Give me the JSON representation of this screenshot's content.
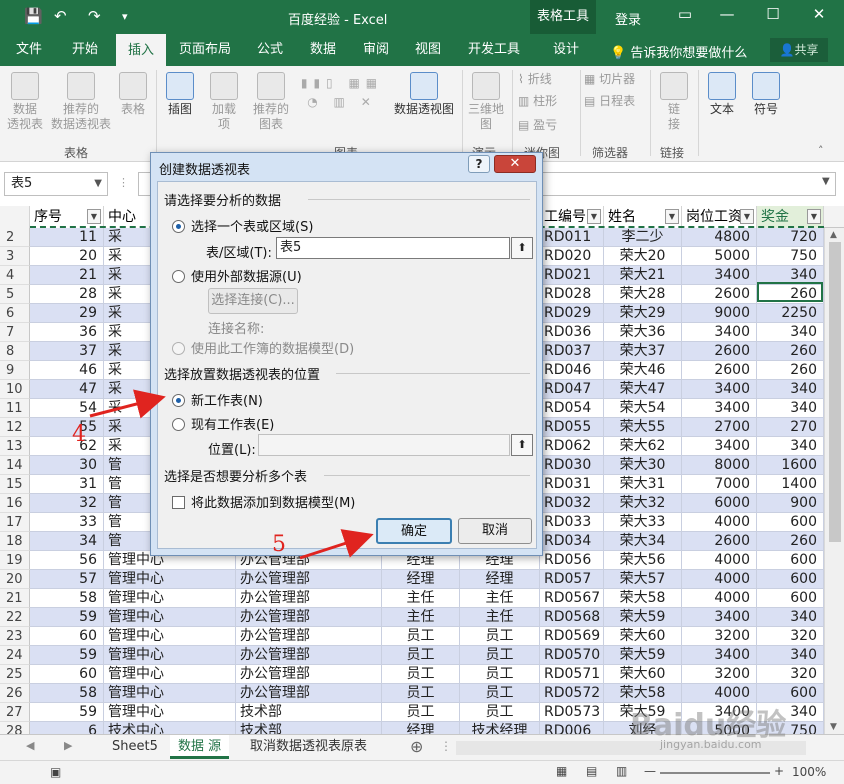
{
  "window": {
    "title": "百度经验 - Excel",
    "context_tab": "表格工具",
    "login": "登录",
    "quick_access": [
      "save-icon",
      "undo-icon",
      "redo-icon",
      "customize-icon"
    ],
    "controls": [
      "ribbon-display-icon",
      "minimize-icon",
      "maximize-icon",
      "close-icon"
    ]
  },
  "ribbon_tabs": [
    "文件",
    "开始",
    "插入",
    "页面布局",
    "公式",
    "数据",
    "审阅",
    "视图",
    "开发工具",
    "设计"
  ],
  "active_tab": "插入",
  "tell_me": "告诉我你想要做什么",
  "share": "共享",
  "ribbon": {
    "buttons": [
      "数据\n透视表",
      "推荐的\n数据透视表",
      "表格",
      "插图",
      "加载\n项",
      "推荐的\n图表",
      "数据透视图",
      "三维地\n图",
      "折线",
      "柱形",
      "盈亏",
      "切片器",
      "日程表",
      "链\n接",
      "文本",
      "符号"
    ],
    "groups": [
      "表格",
      "图表",
      "演示",
      "迷你图",
      "筛选器",
      "链接"
    ]
  },
  "name_box": "表5",
  "columns": [
    "序号",
    "中心",
    "",
    "",
    "",
    "工编号",
    "姓名",
    "岗位工资",
    "奖金"
  ],
  "rows": [
    {
      "n": "2",
      "seq": "11",
      "center": "采",
      "dept": "",
      "pos": "",
      "role": "",
      "id": "RD011",
      "name": "李二少",
      "wage": "4800",
      "bonus": "720"
    },
    {
      "n": "3",
      "seq": "20",
      "center": "采",
      "dept": "",
      "pos": "",
      "role": "",
      "id": "RD020",
      "name": "荣大20",
      "wage": "5000",
      "bonus": "750"
    },
    {
      "n": "4",
      "seq": "21",
      "center": "采",
      "dept": "",
      "pos": "",
      "role": "",
      "id": "RD021",
      "name": "荣大21",
      "wage": "3400",
      "bonus": "340"
    },
    {
      "n": "5",
      "seq": "28",
      "center": "采",
      "dept": "",
      "pos": "",
      "role": "",
      "id": "RD028",
      "name": "荣大28",
      "wage": "2600",
      "bonus": "260"
    },
    {
      "n": "6",
      "seq": "29",
      "center": "采",
      "dept": "",
      "pos": "",
      "role": "",
      "id": "RD029",
      "name": "荣大29",
      "wage": "9000",
      "bonus": "2250"
    },
    {
      "n": "7",
      "seq": "36",
      "center": "采",
      "dept": "",
      "pos": "",
      "role": "",
      "id": "RD036",
      "name": "荣大36",
      "wage": "3400",
      "bonus": "340"
    },
    {
      "n": "8",
      "seq": "37",
      "center": "采",
      "dept": "",
      "pos": "",
      "role": "",
      "id": "RD037",
      "name": "荣大37",
      "wage": "2600",
      "bonus": "260"
    },
    {
      "n": "9",
      "seq": "46",
      "center": "采",
      "dept": "",
      "pos": "",
      "role": "",
      "id": "RD046",
      "name": "荣大46",
      "wage": "2600",
      "bonus": "260"
    },
    {
      "n": "10",
      "seq": "47",
      "center": "采",
      "dept": "",
      "pos": "",
      "role": "",
      "id": "RD047",
      "name": "荣大47",
      "wage": "3400",
      "bonus": "340"
    },
    {
      "n": "11",
      "seq": "54",
      "center": "采",
      "dept": "",
      "pos": "",
      "role": "",
      "id": "RD054",
      "name": "荣大54",
      "wage": "3400",
      "bonus": "340"
    },
    {
      "n": "12",
      "seq": "55",
      "center": "采",
      "dept": "",
      "pos": "",
      "role": "",
      "id": "RD055",
      "name": "荣大55",
      "wage": "2700",
      "bonus": "270"
    },
    {
      "n": "13",
      "seq": "62",
      "center": "采",
      "dept": "",
      "pos": "",
      "role": "",
      "id": "RD062",
      "name": "荣大62",
      "wage": "3400",
      "bonus": "340"
    },
    {
      "n": "14",
      "seq": "30",
      "center": "管",
      "dept": "",
      "pos": "",
      "role": "",
      "id": "RD030",
      "name": "荣大30",
      "wage": "8000",
      "bonus": "1600"
    },
    {
      "n": "15",
      "seq": "31",
      "center": "管",
      "dept": "",
      "pos": "",
      "role": "",
      "id": "RD031",
      "name": "荣大31",
      "wage": "7000",
      "bonus": "1400"
    },
    {
      "n": "16",
      "seq": "32",
      "center": "管",
      "dept": "",
      "pos": "",
      "role": "",
      "id": "RD032",
      "name": "荣大32",
      "wage": "6000",
      "bonus": "900"
    },
    {
      "n": "17",
      "seq": "33",
      "center": "管",
      "dept": "",
      "pos": "",
      "role": "",
      "id": "RD033",
      "name": "荣大33",
      "wage": "4000",
      "bonus": "600"
    },
    {
      "n": "18",
      "seq": "34",
      "center": "管",
      "dept": "",
      "pos": "",
      "role": "",
      "id": "RD034",
      "name": "荣大34",
      "wage": "2600",
      "bonus": "260"
    },
    {
      "n": "19",
      "seq": "56",
      "center": "管理中心",
      "dept": "办公管理部",
      "pos": "经理",
      "role": "经理",
      "id": "RD056",
      "name": "荣大56",
      "wage": "4000",
      "bonus": "600"
    },
    {
      "n": "20",
      "seq": "57",
      "center": "管理中心",
      "dept": "办公管理部",
      "pos": "经理",
      "role": "经理",
      "id": "RD057",
      "name": "荣大57",
      "wage": "4000",
      "bonus": "600"
    },
    {
      "n": "21",
      "seq": "58",
      "center": "管理中心",
      "dept": "办公管理部",
      "pos": "主任",
      "role": "主任",
      "id": "RD0567",
      "name": "荣大58",
      "wage": "4000",
      "bonus": "600"
    },
    {
      "n": "22",
      "seq": "59",
      "center": "管理中心",
      "dept": "办公管理部",
      "pos": "主任",
      "role": "主任",
      "id": "RD0568",
      "name": "荣大59",
      "wage": "3400",
      "bonus": "340"
    },
    {
      "n": "23",
      "seq": "60",
      "center": "管理中心",
      "dept": "办公管理部",
      "pos": "员工",
      "role": "员工",
      "id": "RD0569",
      "name": "荣大60",
      "wage": "3200",
      "bonus": "320"
    },
    {
      "n": "24",
      "seq": "59",
      "center": "管理中心",
      "dept": "办公管理部",
      "pos": "员工",
      "role": "员工",
      "id": "RD0570",
      "name": "荣大59",
      "wage": "3400",
      "bonus": "340"
    },
    {
      "n": "25",
      "seq": "60",
      "center": "管理中心",
      "dept": "办公管理部",
      "pos": "员工",
      "role": "员工",
      "id": "RD0571",
      "name": "荣大60",
      "wage": "3200",
      "bonus": "320"
    },
    {
      "n": "26",
      "seq": "58",
      "center": "管理中心",
      "dept": "办公管理部",
      "pos": "员工",
      "role": "员工",
      "id": "RD0572",
      "name": "荣大58",
      "wage": "4000",
      "bonus": "600"
    },
    {
      "n": "27",
      "seq": "59",
      "center": "管理中心",
      "dept": "技术部",
      "pos": "员工",
      "role": "员工",
      "id": "RD0573",
      "name": "荣大59",
      "wage": "3400",
      "bonus": "340"
    },
    {
      "n": "28",
      "seq": "6",
      "center": "技术中心",
      "dept": "技术部",
      "pos": "经理",
      "role": "技术经理",
      "id": "RD006",
      "name": "刘经",
      "wage": "5000",
      "bonus": "750"
    }
  ],
  "sheet_tabs": [
    "Sheet5",
    "数据 源",
    "取消数据透视表原表"
  ],
  "active_sheet": "数据 源",
  "zoom": "100%",
  "dialog": {
    "title": "创建数据透视表",
    "help": "?",
    "close": "✕",
    "section1": "请选择要分析的数据",
    "opt_range": "选择一个表或区域(S)",
    "range_label": "表/区域(T):",
    "range_value": "表5",
    "opt_external": "使用外部数据源(U)",
    "choose_conn": "选择连接(C)...",
    "conn_name": "连接名称:",
    "opt_model": "使用此工作簿的数据模型(D)",
    "section2": "选择放置数据透视表的位置",
    "opt_new": "新工作表(N)",
    "opt_existing": "现有工作表(E)",
    "location_label": "位置(L):",
    "section3": "选择是否想要分析多个表",
    "add_model": "将此数据添加到数据模型(M)",
    "ok": "确定",
    "cancel": "取消"
  },
  "annotations": {
    "step4": "4",
    "step5": "5",
    "accent": "#e0241f"
  },
  "watermark": {
    "text": "Baidu经验",
    "url_text": "jingyan.baidu.com"
  },
  "colors": {
    "excel_green": "#217346",
    "band": "#dae0f3"
  }
}
